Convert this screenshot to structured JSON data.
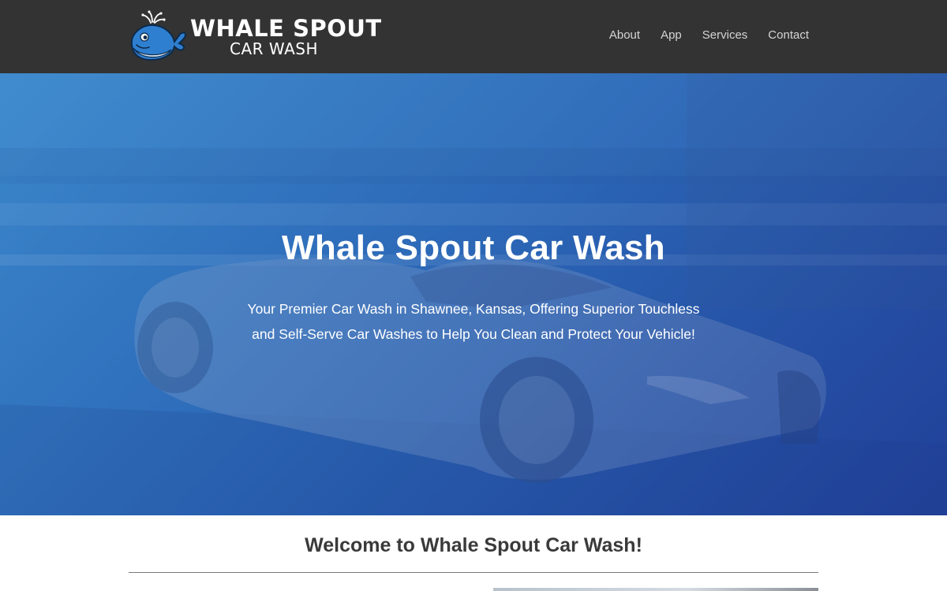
{
  "header": {
    "logo": {
      "title": "WHALE SPOUT",
      "subtitle": "CAR WASH"
    },
    "nav": [
      {
        "label": "About"
      },
      {
        "label": "App"
      },
      {
        "label": "Services"
      },
      {
        "label": "Contact"
      }
    ]
  },
  "hero": {
    "title": "Whale Spout Car Wash",
    "tagline_line1": "Your Premier Car Wash in Shawnee, Kansas, Offering Superior Touchless",
    "tagline_line2": "and Self-Serve Car Washes to Help You Clean and Protect Your Vehicle!"
  },
  "welcome": {
    "title": "Welcome to Whale Spout Car Wash!"
  },
  "colors": {
    "navbar_bg": "#333333",
    "nav_text": "#d5d5d5",
    "hero_blue": "#2e6fba",
    "whale_blue": "#2f7fd0"
  }
}
